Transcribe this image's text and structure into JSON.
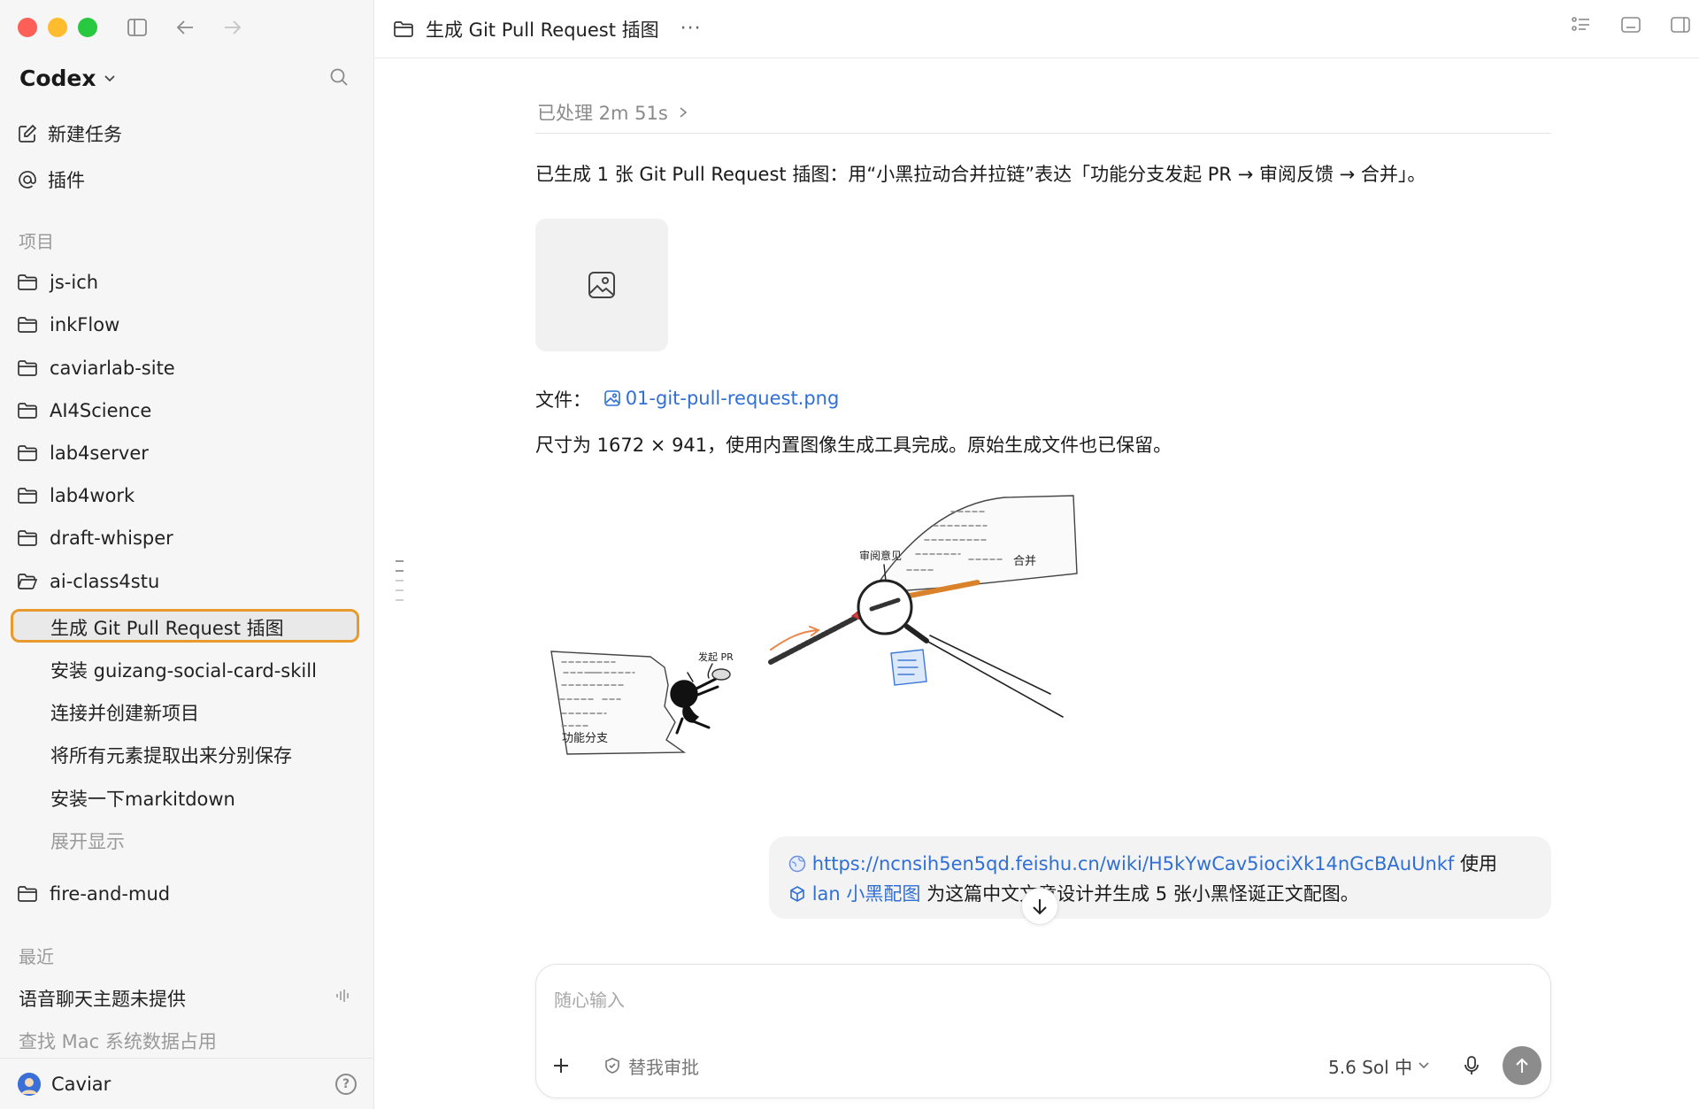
{
  "sidebar": {
    "brand": "Codex",
    "new_task": "新建任务",
    "plugins": "插件",
    "projects_title": "项目",
    "projects": [
      "js-ich",
      "inkFlow",
      "caviarlab-site",
      "AI4Science",
      "lab4server",
      "lab4work",
      "draft-whisper",
      "ai-class4stu"
    ],
    "threads": [
      "生成 Git Pull Request 插图",
      "安装 guizang-social-card-skill",
      "连接并创建新项目",
      "将所有元素提取出来分别保存",
      "安装一下markitdown"
    ],
    "expand": "展开显示",
    "project_after": "fire-and-mud",
    "recent_title": "最近",
    "recent": [
      "语音聊天主题未提供",
      "查找 Mac 系统数据占用"
    ],
    "user": "Caviar"
  },
  "main": {
    "title": "生成 Git Pull Request 插图",
    "processed": "已处理 2m 51s",
    "summary": "已生成 1 张 Git Pull Request 插图：用“小黑拉动合并拉链”表达「功能分支发起 PR → 审阅反馈 → 合并」。",
    "file_label": "文件：",
    "file_name": "01-git-pull-request.png",
    "size_note": "尺寸为 1672 × 941，使用内置图像生成工具完成。原始生成文件也已保留。",
    "illustration": {
      "label_branch": "功能分支",
      "label_pr": "发起 PR",
      "label_review": "审阅意见",
      "label_merge": "合并"
    },
    "user_message": {
      "url": "https://ncnsih5en5qd.feishu.cn/wiki/H5kYwCav5iociXk14nGcBAuUnkf",
      "after_url": " 使用",
      "skill": "lan 小黑配图",
      "rest": " 为这篇中文文章设计并生成 5 张小黑怪诞正文配图。"
    },
    "composer": {
      "placeholder": "随心输入",
      "approval": "替我审批",
      "model": "5.6 Sol 中"
    }
  }
}
